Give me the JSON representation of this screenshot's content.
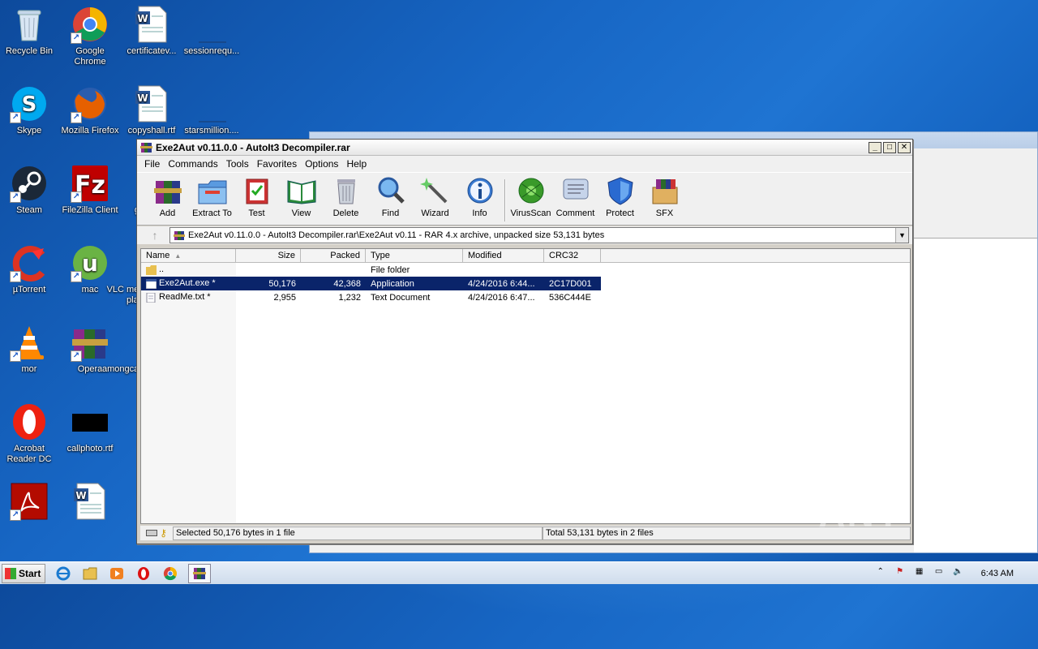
{
  "desktop": {
    "icons": [
      {
        "label": "Recycle Bin"
      },
      {
        "label": "Google Chrome"
      },
      {
        "label": "certificatev..."
      },
      {
        "label": "sessionrequ..."
      },
      {
        "label": "Skype"
      },
      {
        "label": "Mozilla Firefox"
      },
      {
        "label": "copyshall.rtf"
      },
      {
        "label": "starsmillion...."
      },
      {
        "label": "Steam"
      },
      {
        "label": "FileZilla Client"
      },
      {
        "label": "glas"
      },
      {
        "label": "CCleaner"
      },
      {
        "label": "µTorrent"
      },
      {
        "label": "mac"
      },
      {
        "label": "VLC media player"
      },
      {
        "label": "WinRAR"
      },
      {
        "label": "mor"
      },
      {
        "label": "Opera"
      },
      {
        "label": "amongcable...."
      },
      {
        "label": "pa"
      },
      {
        "label": "Acrobat Reader DC"
      },
      {
        "label": "callphoto.rtf"
      },
      {
        "label": "pri"
      }
    ]
  },
  "window": {
    "title": "Exe2Aut v0.11.0.0 - AutoIt3 Decompiler.rar",
    "menu": [
      "File",
      "Commands",
      "Tools",
      "Favorites",
      "Options",
      "Help"
    ],
    "tools": [
      {
        "label": "Add",
        "icon": "add-archive-icon"
      },
      {
        "label": "Extract To",
        "icon": "extract-folder-icon"
      },
      {
        "label": "Test",
        "icon": "test-clipboard-icon"
      },
      {
        "label": "View",
        "icon": "view-book-icon"
      },
      {
        "label": "Delete",
        "icon": "trash-icon"
      },
      {
        "label": "Find",
        "icon": "magnifier-icon"
      },
      {
        "label": "Wizard",
        "icon": "wand-icon"
      },
      {
        "label": "Info",
        "icon": "info-icon"
      },
      {
        "label": "VirusScan",
        "icon": "bug-icon"
      },
      {
        "label": "Comment",
        "icon": "comment-icon"
      },
      {
        "label": "Protect",
        "icon": "shield-icon"
      },
      {
        "label": "SFX",
        "icon": "sfx-box-icon"
      }
    ],
    "address": "Exe2Aut v0.11.0.0 - AutoIt3 Decompiler.rar\\Exe2Aut v0.11 - RAR 4.x archive, unpacked size 53,131 bytes",
    "columns": [
      "Name",
      "Size",
      "Packed",
      "Type",
      "Modified",
      "CRC32"
    ],
    "rows": [
      {
        "name": "..",
        "size": "",
        "packed": "",
        "type": "File folder",
        "modified": "",
        "crc": ""
      },
      {
        "name": "Exe2Aut.exe *",
        "size": "50,176",
        "packed": "42,368",
        "type": "Application",
        "modified": "4/24/2016 6:44...",
        "crc": "2C17D001"
      },
      {
        "name": "ReadMe.txt *",
        "size": "2,955",
        "packed": "1,232",
        "type": "Text Document",
        "modified": "4/24/2016 6:47...",
        "crc": "536C444E"
      }
    ],
    "status_left": "Selected 50,176 bytes in 1 file",
    "status_right": "Total 53,131 bytes in 2 files"
  },
  "taskbar": {
    "start_label": "Start",
    "clock": "6:43 AM"
  },
  "watermark": "ANY RUN"
}
